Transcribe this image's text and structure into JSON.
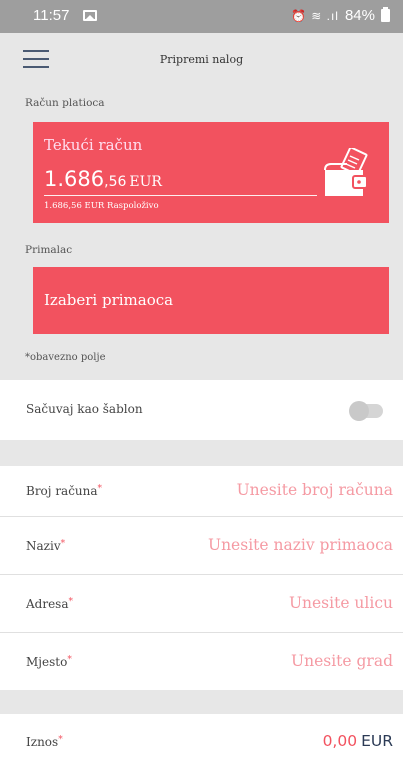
{
  "status_bar": {
    "time": "11:57",
    "system_icons": "⏰ ≋ .ıl",
    "battery": "84%"
  },
  "header": {
    "title": "Pripremi nalog"
  },
  "payer": {
    "section_label": "Račun platioca",
    "account_type": "Tekući račun",
    "balance_int": "1.686",
    "balance_dec": ",56",
    "currency": "EUR",
    "available_text": "1.686,56 EUR Raspoloživo"
  },
  "recipient": {
    "section_label": "Primalac",
    "button_label": "Izaberi primaoca"
  },
  "required_note": "*obavezno polje",
  "template": {
    "label": "Sačuvaj kao šablon",
    "enabled": false
  },
  "fields": [
    {
      "label": "Broj računa",
      "placeholder": "Unesite broj računa"
    },
    {
      "label": "Naziv",
      "placeholder": "Unesite naziv primaoca"
    },
    {
      "label": "Adresa",
      "placeholder": "Unesite ulicu"
    },
    {
      "label": "Mjesto",
      "placeholder": "Unesite grad"
    }
  ],
  "amount": {
    "label": "Iznos",
    "value": "0,00",
    "currency": "EUR"
  },
  "colors": {
    "accent": "#f2525f",
    "placeholder": "#f59aa3",
    "background": "#e7e7e7"
  },
  "icons": {
    "menu": "hamburger-menu-icon",
    "wallet": "wallet-icon"
  }
}
